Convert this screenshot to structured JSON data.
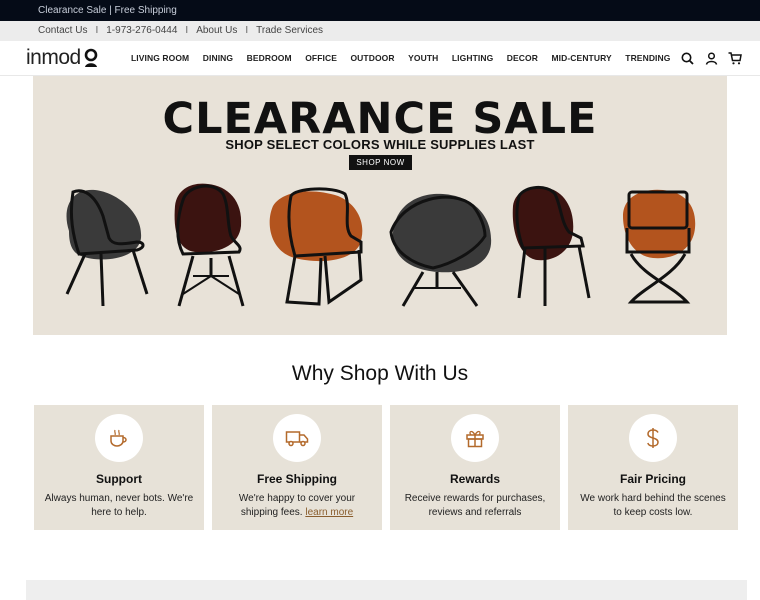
{
  "promo": {
    "text": "Clearance Sale | Free Shipping"
  },
  "util": {
    "contact": "Contact Us",
    "phone": "1-973-276-0444",
    "about": "About Us",
    "trade": "Trade Services",
    "separator": "I"
  },
  "logo": {
    "text_in": "in",
    "text_mod": "mod"
  },
  "nav": {
    "items": [
      "LIVING ROOM",
      "DINING",
      "BEDROOM",
      "OFFICE",
      "OUTDOOR",
      "YOUTH",
      "LIGHTING",
      "DECOR",
      "MID-CENTURY",
      "TRENDING"
    ],
    "icons": [
      "search-icon",
      "account-icon",
      "cart-icon"
    ]
  },
  "hero": {
    "title": "CLEARANCE SALE",
    "subtitle": "SHOP SELECT COLORS WHILE SUPPLIES LAST",
    "button": "SHOP NOW",
    "colors": {
      "background": "#e8e2d8",
      "charcoal": "#3a3a3a",
      "maroon": "#3b1310",
      "rust": "#b3541e",
      "outline": "#111111"
    }
  },
  "why": {
    "title": "Why Shop With Us",
    "cards": [
      {
        "icon": "coffee-cup-icon",
        "title": "Support",
        "text": "Always human, never bots. We're here to help."
      },
      {
        "icon": "truck-icon",
        "title": "Free Shipping",
        "text": "We're happy to cover your shipping fees.",
        "link": "learn more"
      },
      {
        "icon": "gift-icon",
        "title": "Rewards",
        "text": "Receive rewards for purchases, reviews and referrals"
      },
      {
        "icon": "dollar-icon",
        "title": "Fair Pricing",
        "text": "We work hard behind the scenes to keep costs low."
      }
    ]
  }
}
